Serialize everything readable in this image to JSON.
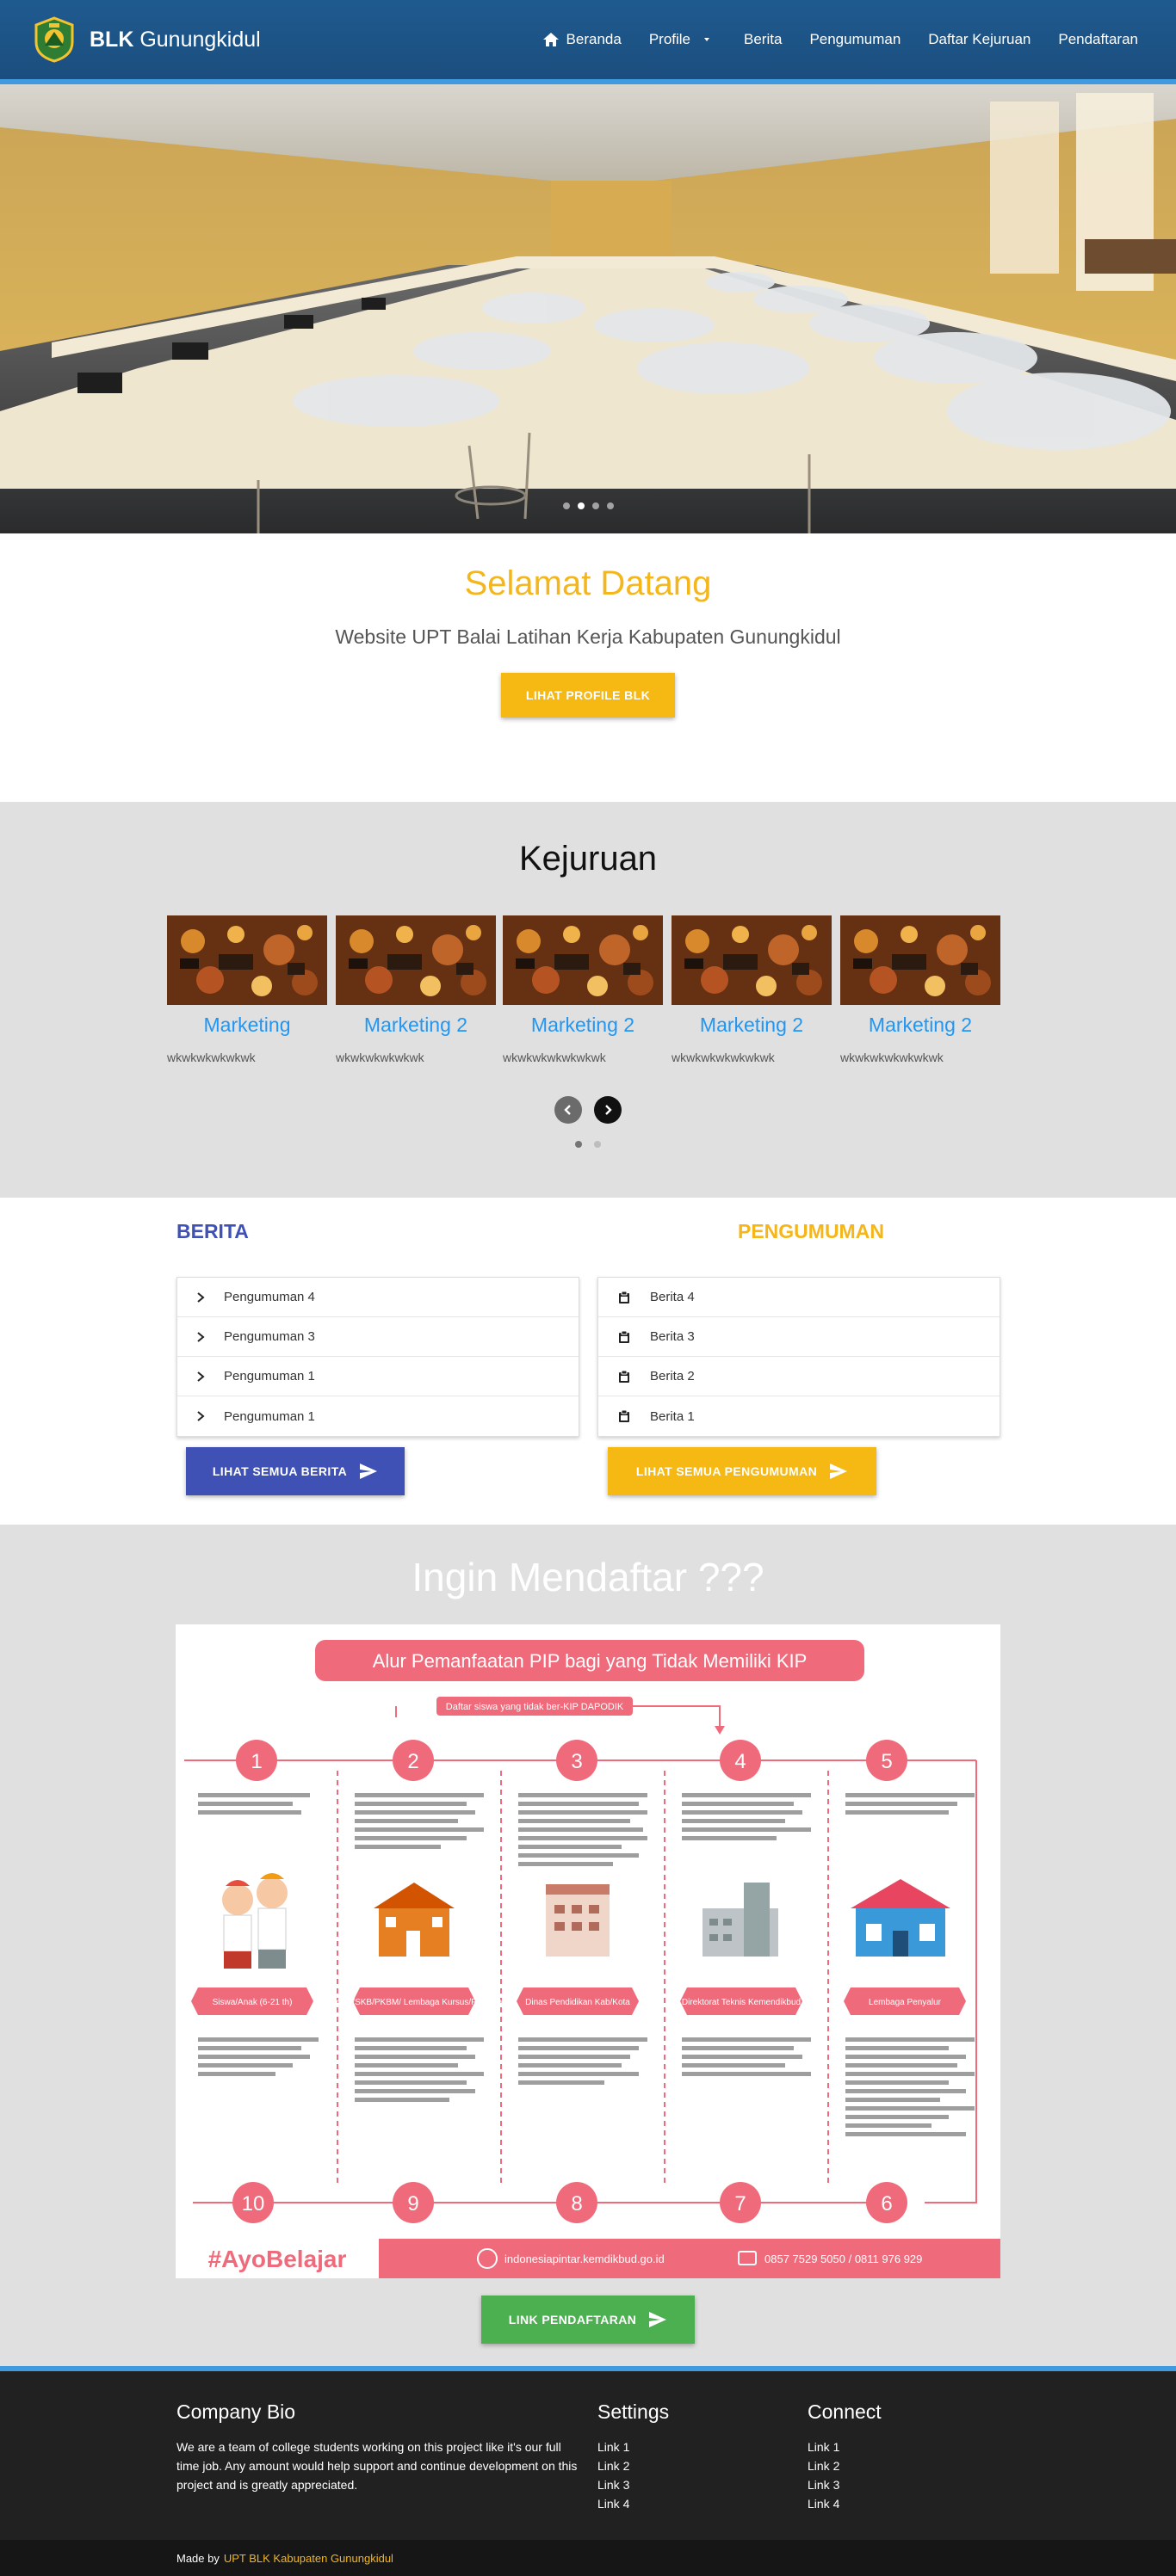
{
  "brand": {
    "bold": "BLK",
    "light": " Gunungkidul"
  },
  "nav": [
    {
      "label": "Beranda",
      "icon": "home-icon"
    },
    {
      "label": "Profile",
      "icon": "caret-down-icon"
    },
    {
      "label": "Berita"
    },
    {
      "label": "Pengumuman"
    },
    {
      "label": "Daftar Kejuruan"
    },
    {
      "label": "Pendaftaran"
    }
  ],
  "hero": {
    "slides": 4,
    "active_slide": 2
  },
  "welcome": {
    "title": "Selamat Datang",
    "subtitle": "Website UPT Balai Latihan Kerja Kabupaten Gunungkidul",
    "button": "LIHAT PROFILE BLK"
  },
  "kejuruan": {
    "title": "Kejuruan",
    "cards": [
      {
        "title": "Marketing",
        "desc": "wkwkwkwkwkwk"
      },
      {
        "title": "Marketing 2",
        "desc": "wkwkwkwkwkwk"
      },
      {
        "title": "Marketing 2",
        "desc": "wkwkwkwkwkwkwk"
      },
      {
        "title": "Marketing 2",
        "desc": "wkwkwkwkwkwkwk"
      },
      {
        "title": "Marketing 2",
        "desc": "wkwkwkwkwkwkwk"
      }
    ],
    "pages": 2,
    "active_page": 1
  },
  "berita": {
    "title": "BERITA",
    "items": [
      "Pengumuman 4",
      "Pengumuman 3",
      "Pengumuman 1",
      "Pengumuman 1"
    ],
    "button": "LIHAT SEMUA BERITA"
  },
  "pengumuman": {
    "title": "PENGUMUMAN",
    "items": [
      "Berita 4",
      "Berita 3",
      "Berita 2",
      "Berita 1"
    ],
    "button": "LIHAT SEMUA PENGUMUMAN"
  },
  "daftar": {
    "title": "Ingin Mendaftar ???",
    "button": "LINK PENDAFTARAN",
    "poster": {
      "title": "Alur Pemanfaatan PIP bagi yang Tidak Memiliki KIP",
      "tag": "Daftar siswa yang tidak ber-KIP DAPODIK",
      "steps_top": [
        "1",
        "2",
        "3",
        "4",
        "5"
      ],
      "steps_bottom": [
        "10",
        "9",
        "8",
        "7",
        "6"
      ],
      "labels": [
        "Siswa/Anak (6-21 th)",
        "Sekolah/SKB/PKBM/ Lembaga Kursus/Pelatihan",
        "Dinas Pendidikan Kab/Kota",
        "Direktorat Teknis Kemendikbud",
        "Lembaga Penyalur"
      ],
      "hashtag": "#AyoBelajar",
      "site": "indonesiapintar.kemdikbud.go.id",
      "phone": "0857 7529 5050 / 0811 976 929"
    }
  },
  "footer": {
    "bio_title": "Company Bio",
    "bio_text": "We are a team of college students working on this project like it's our full time job. Any amount would help support and continue development on this project and is greatly appreciated.",
    "settings_title": "Settings",
    "settings_links": [
      "Link 1",
      "Link 2",
      "Link 3",
      "Link 4"
    ],
    "connect_title": "Connect",
    "connect_links": [
      "Link 1",
      "Link 2",
      "Link 3",
      "Link 4"
    ],
    "made_by_prefix": "Made by",
    "made_by_link": "UPT BLK Kabupaten Gunungkidul"
  },
  "colors": {
    "navy": "#1f5a8f",
    "accent_blue": "#3f9ae0",
    "yellow": "#f4b61a",
    "indigo": "#3f51b5",
    "green": "#4caf50",
    "link_blue": "#2196f3",
    "poster_pink": "#ef6b7b"
  }
}
